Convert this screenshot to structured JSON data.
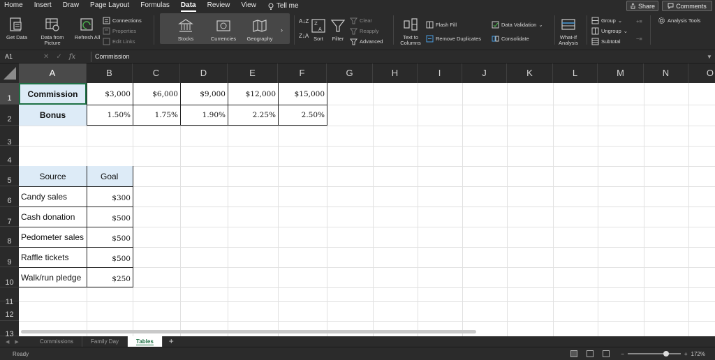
{
  "menu": {
    "tabs": [
      "Home",
      "Insert",
      "Draw",
      "Page Layout",
      "Formulas",
      "Data",
      "Review",
      "View"
    ],
    "active_tab": "Data",
    "tell_me": "Tell me",
    "share": "Share",
    "comments": "Comments"
  },
  "ribbon": {
    "get_data": "Get Data",
    "data_from_picture": "Data from Picture",
    "refresh_all": "Refresh All",
    "connections": "Connections",
    "properties": "Properties",
    "edit_links": "Edit Links",
    "stocks": "Stocks",
    "currencies": "Currencies",
    "geography": "Geography",
    "sort": "Sort",
    "filter": "Filter",
    "clear": "Clear",
    "reapply": "Reapply",
    "advanced": "Advanced",
    "text_to_columns": "Text to Columns",
    "flash_fill": "Flash Fill",
    "remove_duplicates": "Remove Duplicates",
    "data_validation": "Data Validation",
    "consolidate": "Consolidate",
    "what_if": "What-If Analysis",
    "group": "Group",
    "ungroup": "Ungroup",
    "subtotal": "Subtotal",
    "analysis_tools": "Analysis Tools"
  },
  "formula_bar": {
    "name_box": "A1",
    "fx": "fx",
    "value": "Commission"
  },
  "columns": [
    "A",
    "B",
    "C",
    "D",
    "E",
    "F",
    "G",
    "H",
    "I",
    "J",
    "K",
    "L",
    "M",
    "N",
    "O"
  ],
  "rows": [
    "1",
    "2",
    "3",
    "4",
    "5",
    "6",
    "7",
    "8",
    "9",
    "10",
    "11",
    "12",
    "13"
  ],
  "sheet": {
    "row1": {
      "label": "Commission",
      "values": [
        "$3,000",
        "$6,000",
        "$9,000",
        "$12,000",
        "$15,000"
      ]
    },
    "row2": {
      "label": "Bonus",
      "values": [
        "1.50%",
        "1.75%",
        "1.90%",
        "2.25%",
        "2.50%"
      ]
    },
    "table_headers": {
      "source": "Source",
      "goal": "Goal"
    },
    "table_rows": [
      {
        "source": "Candy sales",
        "goal": "$300"
      },
      {
        "source": "Cash donation",
        "goal": "$500"
      },
      {
        "source": "Pedometer sales",
        "goal": "$500"
      },
      {
        "source": "Raffle tickets",
        "goal": "$500"
      },
      {
        "source": "Walk/run pledge",
        "goal": "$250"
      }
    ]
  },
  "sheet_tabs": [
    "Commissions",
    "Family Day",
    "Tables"
  ],
  "active_sheet": "Tables",
  "status": {
    "text": "Ready",
    "zoom": "172%",
    "zoom_level": 0.72
  },
  "colors": {
    "accent": "#1e7145",
    "header_fill": "#ddebf7",
    "chrome": "#2b2b2b"
  }
}
